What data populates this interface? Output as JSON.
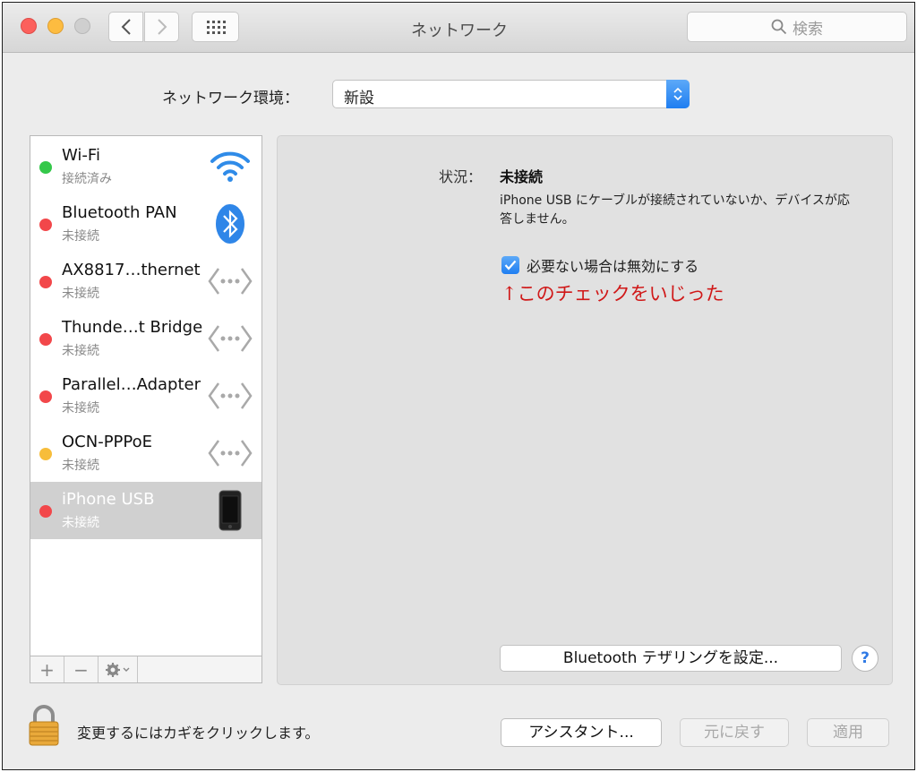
{
  "window": {
    "title": "ネットワーク"
  },
  "search": {
    "placeholder": "検索",
    "icon": "search-icon"
  },
  "location": {
    "label": "ネットワーク環境：",
    "value": "新設"
  },
  "services": [
    {
      "name": "Wi-Fi",
      "status": "接続済み",
      "dot_color": "#34c84a",
      "icon": "wifi-icon"
    },
    {
      "name": "Bluetooth PAN",
      "status": "未接続",
      "dot_color": "#f2474a",
      "icon": "bluetooth-icon"
    },
    {
      "name": "AX8817…thernet",
      "status": "未接続",
      "dot_color": "#f2474a",
      "icon": "ethernet-icon"
    },
    {
      "name": "Thunde…t Bridge",
      "status": "未接続",
      "dot_color": "#f2474a",
      "icon": "ethernet-icon"
    },
    {
      "name": "Parallel…Adapter",
      "status": "未接続",
      "dot_color": "#f2474a",
      "icon": "ethernet-icon"
    },
    {
      "name": "OCN-PPPoE",
      "status": "未接続",
      "dot_color": "#f7bd3b",
      "icon": "ethernet-icon"
    },
    {
      "name": "iPhone USB",
      "status": "未接続",
      "dot_color": "#f2474a",
      "icon": "iphone-icon",
      "selected": true
    }
  ],
  "sidebar_toolbar": {
    "add": "+",
    "remove": "−"
  },
  "detail": {
    "status_label": "状況：",
    "status_value": "未接続",
    "status_description": "iPhone USB にケーブルが接続されていないか、デバイスが応答しません。",
    "checkbox_label": "必要ない場合は無効にする",
    "checkbox_checked": true,
    "annotation": "↑このチェックをいじった",
    "bluetooth_button": "Bluetooth テザリングを設定...",
    "help": "?"
  },
  "footer": {
    "lock_text": "変更するにはカギをクリックします。",
    "assistant_button": "アシスタント...",
    "revert_button": "元に戻す",
    "apply_button": "適用"
  }
}
